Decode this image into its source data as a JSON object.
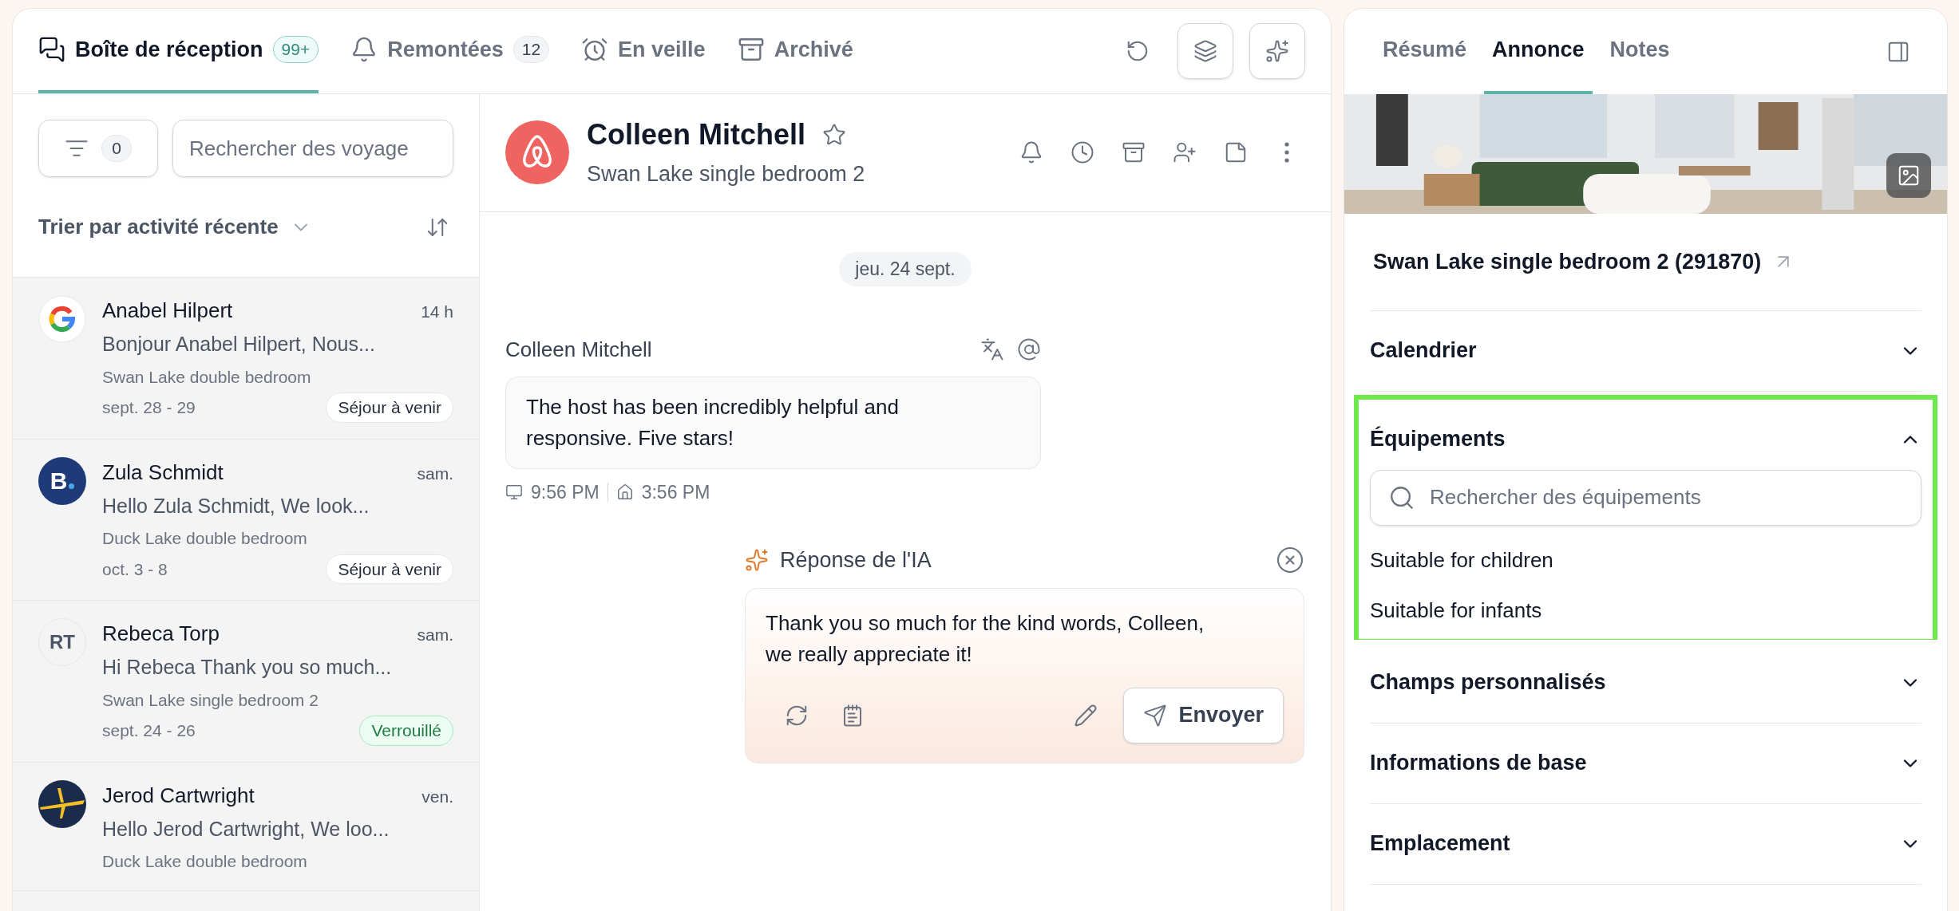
{
  "inbox_tabs": [
    {
      "label": "Boîte de réception",
      "count": "99+",
      "selected": true
    },
    {
      "label": "Remontées",
      "count": "12",
      "selected": false
    },
    {
      "label": "En veille",
      "selected": false
    },
    {
      "label": "Archivé",
      "selected": false
    }
  ],
  "filter": {
    "count": "0"
  },
  "search": {
    "placeholder": "Rechercher des voyage"
  },
  "sort": {
    "label": "Trier par activité récente"
  },
  "conversations": [
    {
      "name": "Anabel Hilpert",
      "time": "14 h",
      "preview": "Bonjour Anabel Hilpert, Nous...",
      "listing": "Swan Lake double bedroom",
      "dates": "sept. 28 - 29",
      "status": {
        "label": "Séjour à venir",
        "kind": "upcoming"
      },
      "kind": "google"
    },
    {
      "name": "Zula Schmidt",
      "time": "sam.",
      "preview": "Hello Zula Schmidt, We look...",
      "listing": "Duck Lake double bedroom",
      "dates": "oct. 3 - 8",
      "status": {
        "label": "Séjour à venir",
        "kind": "upcoming"
      },
      "kind": "booking",
      "avatar_text": "B"
    },
    {
      "name": "Rebeca Torp",
      "time": "sam.",
      "preview": "Hi Rebeca Thank you so much...",
      "listing": "Swan Lake single bedroom 2",
      "dates": "sept. 24 - 26",
      "status": {
        "label": "Verrouillé",
        "kind": "locked"
      },
      "kind": "initials",
      "avatar_text": "RT"
    },
    {
      "name": "Jerod Cartwright",
      "time": "ven.",
      "preview": "Hello Jerod Cartwright, We loo...",
      "listing": "Duck Lake double bedroom",
      "kind": "expedia"
    }
  ],
  "conversation": {
    "name": "Colleen Mitchell",
    "listing": "Swan Lake single bedroom 2",
    "date": "jeu. 24 sept.",
    "messages": [
      {
        "author": "Colleen Mitchell",
        "text": "The host has been incredibly helpful and responsive. Five stars!",
        "guest_time": "9:56 PM",
        "host_time": "3:56 PM"
      }
    ],
    "ai_reply": {
      "title": "Réponse de l'IA",
      "text": "Thank you so much for the kind words, Colleen, we really appreciate it!",
      "send_label": "Envoyer"
    }
  },
  "side_panel": {
    "tabs": [
      {
        "label": "Résumé",
        "selected": false
      },
      {
        "label": "Annonce",
        "selected": true
      },
      {
        "label": "Notes",
        "selected": false
      }
    ],
    "listing_title": "Swan Lake single bedroom 2 (291870)",
    "sections": [
      {
        "title": "Calendrier",
        "expanded": false,
        "highlighted": false
      },
      {
        "title": "Équipements",
        "expanded": true,
        "highlighted": true,
        "search_placeholder": "Rechercher des équipements",
        "items": [
          "Suitable for children",
          "Suitable for infants"
        ]
      },
      {
        "title": "Champs personnalisés",
        "expanded": false,
        "highlighted": false
      },
      {
        "title": "Informations de base",
        "expanded": false,
        "highlighted": false
      },
      {
        "title": "Emplacement",
        "expanded": false,
        "highlighted": false
      }
    ]
  }
}
